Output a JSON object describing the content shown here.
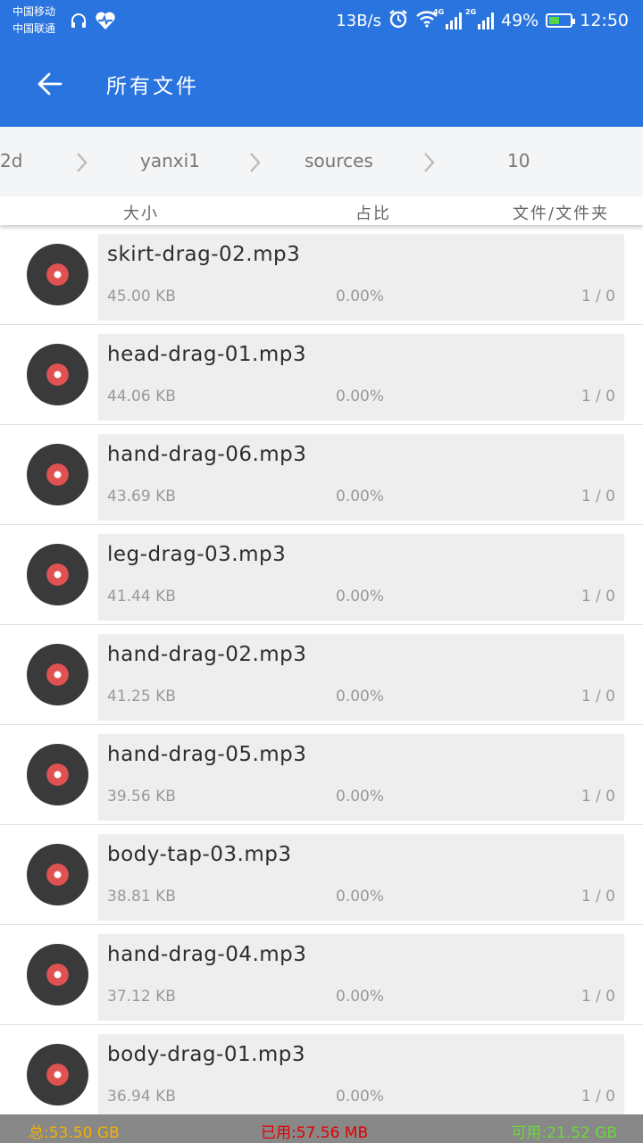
{
  "status_bar": {
    "carrier_1": "中国移动",
    "carrier_2": "中国联通",
    "speed": "13B/s",
    "net_1": "4G",
    "net_2": "2G",
    "battery": "49%",
    "battery_level": 0.49,
    "time": "12:50",
    "icons": [
      "headphones-icon",
      "heart-pulse-icon",
      "alarm-icon",
      "wifi-icon",
      "signal-icon",
      "battery-icon"
    ]
  },
  "app_bar": {
    "title": "所有文件",
    "back_icon": "arrow-left-icon"
  },
  "breadcrumb": [
    "2d",
    "yanxi1",
    "sources",
    "10"
  ],
  "columns": {
    "size": "大小",
    "ratio": "占比",
    "count": "文件/文件夹"
  },
  "files": [
    {
      "name": "skirt-drag-02.mp3",
      "size": "45.00 KB",
      "ratio": "0.00%",
      "count": "1 / 0"
    },
    {
      "name": "head-drag-01.mp3",
      "size": "44.06 KB",
      "ratio": "0.00%",
      "count": "1 / 0"
    },
    {
      "name": "hand-drag-06.mp3",
      "size": "43.69 KB",
      "ratio": "0.00%",
      "count": "1 / 0"
    },
    {
      "name": "leg-drag-03.mp3",
      "size": "41.44 KB",
      "ratio": "0.00%",
      "count": "1 / 0"
    },
    {
      "name": "hand-drag-02.mp3",
      "size": "41.25 KB",
      "ratio": "0.00%",
      "count": "1 / 0"
    },
    {
      "name": "hand-drag-05.mp3",
      "size": "39.56 KB",
      "ratio": "0.00%",
      "count": "1 / 0"
    },
    {
      "name": "body-tap-03.mp3",
      "size": "38.81 KB",
      "ratio": "0.00%",
      "count": "1 / 0"
    },
    {
      "name": "hand-drag-04.mp3",
      "size": "37.12 KB",
      "ratio": "0.00%",
      "count": "1 / 0"
    },
    {
      "name": "body-drag-01.mp3",
      "size": "36.94 KB",
      "ratio": "0.00%",
      "count": "1 / 0"
    }
  ],
  "footer": {
    "total": "总:53.50 GB",
    "used": "已用:57.56 MB",
    "available": "可用:21.52 GB"
  },
  "colors": {
    "primary": "#2a74df",
    "total": "#f5b000",
    "used": "#e00000",
    "available": "#6cd83a",
    "disc": "#3a3a3a",
    "disc_label": "#e05252"
  }
}
